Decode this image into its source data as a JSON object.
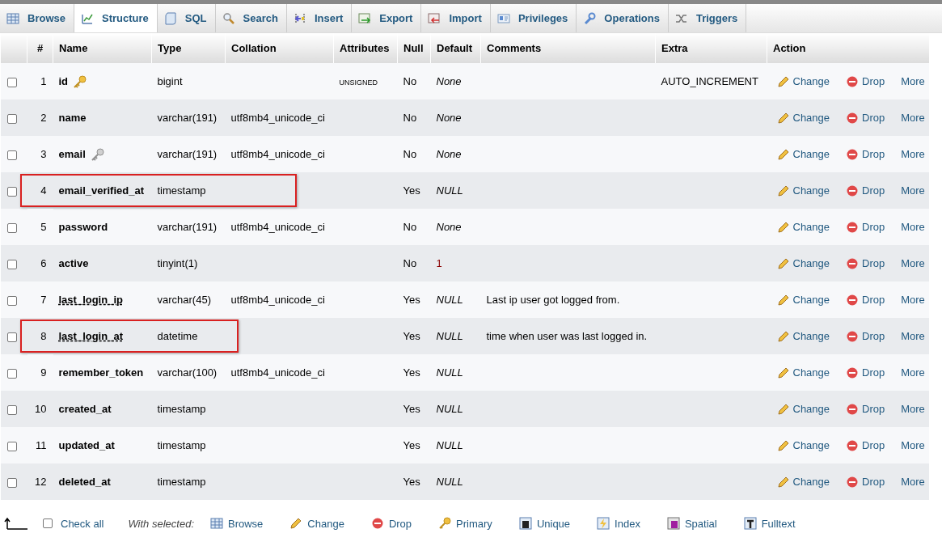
{
  "tabs": [
    {
      "label": "Browse",
      "selected": false
    },
    {
      "label": "Structure",
      "selected": true
    },
    {
      "label": "SQL",
      "selected": false
    },
    {
      "label": "Search",
      "selected": false
    },
    {
      "label": "Insert",
      "selected": false
    },
    {
      "label": "Export",
      "selected": false
    },
    {
      "label": "Import",
      "selected": false
    },
    {
      "label": "Privileges",
      "selected": false
    },
    {
      "label": "Operations",
      "selected": false
    },
    {
      "label": "Triggers",
      "selected": false
    }
  ],
  "table": {
    "columns": [
      "#",
      "Name",
      "Type",
      "Collation",
      "Attributes",
      "Null",
      "Default",
      "Comments",
      "Extra",
      "Action"
    ],
    "rows": [
      {
        "num": "1",
        "name": "id",
        "primary": true,
        "unique": false,
        "commented": false,
        "highlighted": false,
        "checked": false,
        "type": "bigint",
        "attributes": "UNSIGNED",
        "null": "No",
        "default": "None",
        "keyword": true,
        "extra": "AUTO_INCREMENT",
        "actions": [
          "Change",
          "Drop",
          "More"
        ]
      },
      {
        "num": "2",
        "name": "name",
        "primary": false,
        "unique": false,
        "commented": false,
        "highlighted": false,
        "checked": false,
        "type": "varchar(191)",
        "collation": "utf8mb4_unicode_ci",
        "null": "No",
        "default": "None",
        "keyword": true,
        "actions": [
          "Change",
          "Drop",
          "More"
        ]
      },
      {
        "num": "3",
        "name": "email",
        "primary": false,
        "unique": true,
        "commented": false,
        "highlighted": false,
        "checked": false,
        "type": "varchar(191)",
        "collation": "utf8mb4_unicode_ci",
        "null": "No",
        "default": "None",
        "keyword": true,
        "actions": [
          "Change",
          "Drop",
          "More"
        ]
      },
      {
        "num": "4",
        "name": "email_verified_at",
        "primary": false,
        "unique": false,
        "commented": false,
        "highlighted": true,
        "checked": false,
        "type": "timestamp",
        "null": "Yes",
        "default": "NULL",
        "keyword": true,
        "actions": [
          "Change",
          "Drop",
          "More"
        ]
      },
      {
        "num": "5",
        "name": "password",
        "primary": false,
        "unique": false,
        "commented": false,
        "highlighted": false,
        "checked": false,
        "type": "varchar(191)",
        "collation": "utf8mb4_unicode_ci",
        "null": "No",
        "default": "None",
        "keyword": true,
        "actions": [
          "Change",
          "Drop",
          "More"
        ]
      },
      {
        "num": "6",
        "name": "active",
        "primary": false,
        "unique": false,
        "commented": false,
        "highlighted": false,
        "checked": false,
        "type": "tinyint(1)",
        "null": "No",
        "default": "1",
        "keyword": false,
        "actions": [
          "Change",
          "Drop",
          "More"
        ]
      },
      {
        "num": "7",
        "name": "last_login_ip",
        "primary": false,
        "unique": false,
        "commented": true,
        "highlighted": false,
        "checked": false,
        "type": "varchar(45)",
        "collation": "utf8mb4_unicode_ci",
        "null": "Yes",
        "default": "NULL",
        "keyword": true,
        "comments": "Last ip user got logged from.",
        "actions": [
          "Change",
          "Drop",
          "More"
        ]
      },
      {
        "num": "8",
        "name": "last_login_at",
        "primary": false,
        "unique": false,
        "commented": true,
        "highlighted": true,
        "checked": false,
        "type": "datetime",
        "null": "Yes",
        "default": "NULL",
        "keyword": true,
        "comments": "time when user was last logged in.",
        "actions": [
          "Change",
          "Drop",
          "More"
        ]
      },
      {
        "num": "9",
        "name": "remember_token",
        "primary": false,
        "unique": false,
        "commented": false,
        "highlighted": false,
        "checked": false,
        "type": "varchar(100)",
        "collation": "utf8mb4_unicode_ci",
        "null": "Yes",
        "default": "NULL",
        "keyword": true,
        "actions": [
          "Change",
          "Drop",
          "More"
        ]
      },
      {
        "num": "10",
        "name": "created_at",
        "primary": false,
        "unique": false,
        "commented": false,
        "highlighted": false,
        "checked": false,
        "type": "timestamp",
        "null": "Yes",
        "default": "NULL",
        "keyword": true,
        "actions": [
          "Change",
          "Drop",
          "More"
        ]
      },
      {
        "num": "11",
        "name": "updated_at",
        "primary": false,
        "unique": false,
        "commented": false,
        "highlighted": false,
        "checked": false,
        "type": "timestamp",
        "null": "Yes",
        "default": "NULL",
        "keyword": true,
        "actions": [
          "Change",
          "Drop",
          "More"
        ]
      },
      {
        "num": "12",
        "name": "deleted_at",
        "primary": false,
        "unique": false,
        "commented": false,
        "highlighted": false,
        "checked": false,
        "type": "timestamp",
        "null": "Yes",
        "default": "NULL",
        "keyword": true,
        "actions": [
          "Change",
          "Drop",
          "More"
        ]
      }
    ]
  },
  "footer": {
    "check_all": {
      "label": "Check all",
      "checked": false
    },
    "with_selected": "With selected:",
    "actions": [
      "Browse",
      "Change",
      "Drop",
      "Primary",
      "Unique",
      "Index",
      "Spatial",
      "Fulltext"
    ]
  }
}
